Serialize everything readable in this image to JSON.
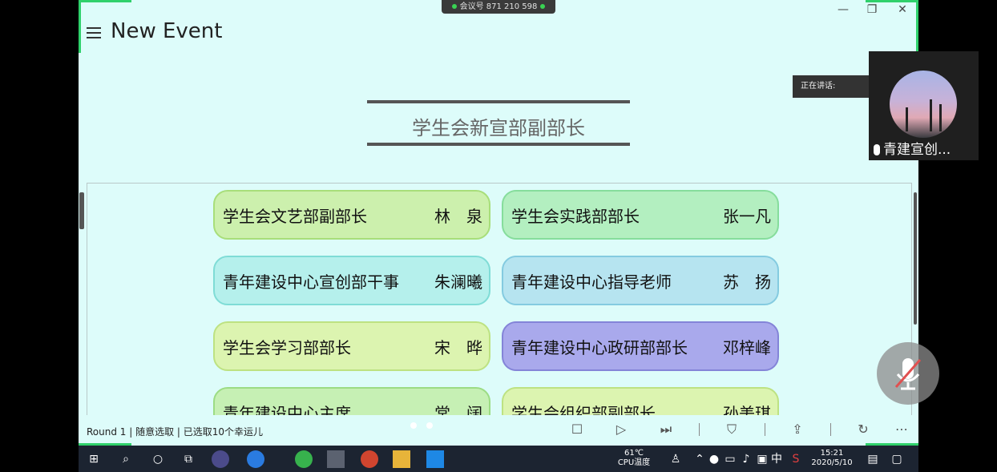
{
  "window": {
    "title": "New Event",
    "minimize": "—",
    "restore": "❐",
    "close": "✕"
  },
  "meeting": {
    "label": "会议号 871 210 598"
  },
  "heading": "学生会新宣部副部长",
  "cards": [
    {
      "role": "学生会文艺部副部长",
      "name": "林　泉",
      "bg": "#ccf0ad",
      "border": "#a8de7a"
    },
    {
      "role": "学生会实践部部长",
      "name": "张一凡",
      "bg": "#b3efc0",
      "border": "#86dd9c"
    },
    {
      "role": "青年建设中心宣创部干事",
      "name": "朱澜曦",
      "bg": "#b5f0ec",
      "border": "#7fdcd6"
    },
    {
      "role": "青年建设中心指导老师",
      "name": "苏　扬",
      "bg": "#b6e4f0",
      "border": "#84cbe0"
    },
    {
      "role": "学生会学习部部长",
      "name": "宋　晔",
      "bg": "#dcf4b0",
      "border": "#bde282"
    },
    {
      "role": "青年建设中心政研部部长",
      "name": "邓梓峰",
      "bg": "#a9a9ec",
      "border": "#8484d8"
    },
    {
      "role": "青年建设中心主席",
      "name": "常　阔",
      "bg": "#c6f0b4",
      "border": "#9cdc84"
    },
    {
      "role": "学生会组织部副部长",
      "name": "孙美琪",
      "bg": "#dcf4b0",
      "border": "#bde282"
    }
  ],
  "status": {
    "round_text": "Round 1 | 随意选取 | 已选取10个幸运儿"
  },
  "controls": {
    "stop": "☐",
    "play": "▷",
    "next": "⏭",
    "filter": "⛉",
    "share": "⇪",
    "reset": "↻",
    "more": "⋯"
  },
  "speaking": {
    "label": "正在讲话:"
  },
  "participant": {
    "name": "青建宣创..."
  },
  "taskbar": {
    "start": "⊞",
    "search": "⌕",
    "cortana": "○",
    "taskview": "⧉",
    "temp": "61℃",
    "cpu_label": "CPU温度",
    "ime": "中",
    "time": "15:21",
    "date": "2020/5/10"
  },
  "colors": {
    "accent_green": "#2fd16b",
    "app_bg": "#ddfcfa"
  }
}
